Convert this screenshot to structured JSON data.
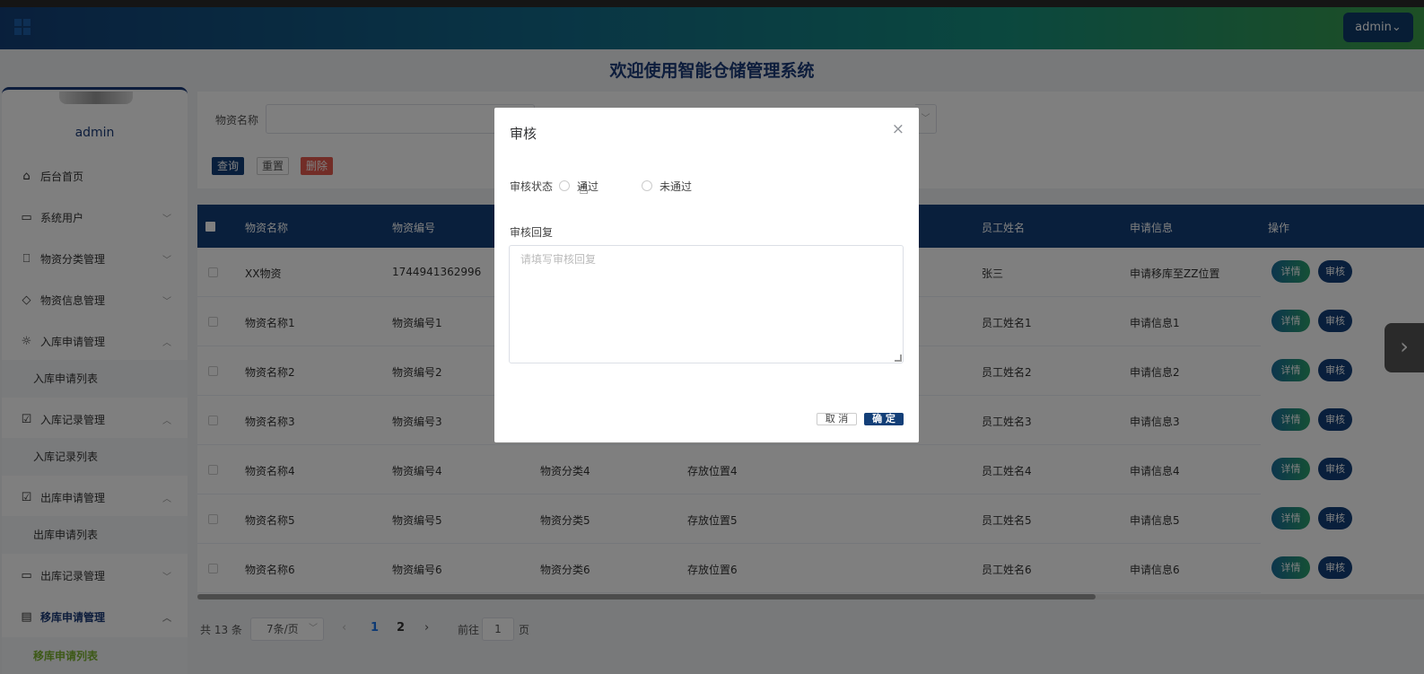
{
  "header": {
    "user_label": "admin⌄",
    "title": "欢迎使用智能仓储管理系统",
    "grid_icon": "grid-icon"
  },
  "sidebar": {
    "name": "admin",
    "items": [
      {
        "label": "后台首页",
        "icon": "home-icon"
      },
      {
        "label": "系统用户",
        "icon": "monitor-icon"
      },
      {
        "label": "物资分类管理",
        "icon": "bookmark-icon"
      },
      {
        "label": "物资信息管理",
        "icon": "tag-icon"
      },
      {
        "label": "入库申请管理",
        "icon": "sun-icon"
      },
      {
        "label": "入库申请列表"
      },
      {
        "label": "入库记录管理",
        "icon": "checkbox-icon"
      },
      {
        "label": "入库记录列表"
      },
      {
        "label": "出库申请管理",
        "icon": "clipboard-check-icon"
      },
      {
        "label": "出库申请列表"
      },
      {
        "label": "出库记录管理",
        "icon": "chat-icon"
      },
      {
        "label": "移库申请管理",
        "icon": "archive-icon"
      },
      {
        "label": "移库申请列表"
      }
    ]
  },
  "search": {
    "label": "物资名称",
    "query_button": "查询",
    "reset_button": "重置",
    "delete_button": "删除"
  },
  "table": {
    "headers": [
      "物资名称",
      "物资编号",
      "员工姓名",
      "申请信息",
      "操作"
    ],
    "detail_label": "详情",
    "audit_label": "审核",
    "rows": [
      {
        "name": "XX物资",
        "code": "1744941362996",
        "category": "",
        "location": "",
        "employee": "张三",
        "info": "申请移库至ZZ位置"
      },
      {
        "name": "物资名称1",
        "code": "物资编号1",
        "category": "",
        "location": "",
        "employee": "员工姓名1",
        "info": "申请信息1"
      },
      {
        "name": "物资名称2",
        "code": "物资编号2",
        "category": "",
        "location": "",
        "employee": "员工姓名2",
        "info": "申请信息2"
      },
      {
        "name": "物资名称3",
        "code": "物资编号3",
        "category": "",
        "location": "",
        "employee": "员工姓名3",
        "info": "申请信息3"
      },
      {
        "name": "物资名称4",
        "code": "物资编号4",
        "category": "物资分类4",
        "location": "存放位置4",
        "employee": "员工姓名4",
        "info": "申请信息4"
      },
      {
        "name": "物资名称5",
        "code": "物资编号5",
        "category": "物资分类5",
        "location": "存放位置5",
        "employee": "员工姓名5",
        "info": "申请信息5"
      },
      {
        "name": "物资名称6",
        "code": "物资编号6",
        "category": "物资分类6",
        "location": "存放位置6",
        "employee": "员工姓名6",
        "info": "申请信息6"
      }
    ]
  },
  "pagination": {
    "total": "共 13 条",
    "page_size": "7条/页",
    "pages": [
      "1",
      "2"
    ],
    "current_page": "1",
    "goto_label": "前往",
    "goto_value": "1",
    "page_suffix": "页"
  },
  "modal": {
    "title": "审核",
    "close": "×",
    "status_label": "审核状态",
    "options": [
      "通过",
      "未通过"
    ],
    "reply_label": "审核回复",
    "reply_placeholder": "请填写审核回复",
    "cancel": "取 消",
    "confirm": "确 定"
  },
  "colors": {
    "primary": "#133f78",
    "accent_green": "#2aa06b",
    "danger": "#e45a4e",
    "active_menu": "#7ab32e"
  }
}
